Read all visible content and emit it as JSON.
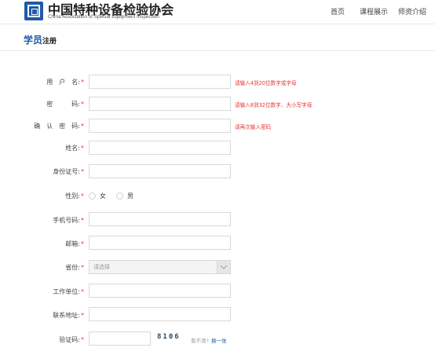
{
  "header": {
    "logo_cn": "中国特种设备检验协会",
    "logo_en": "China Association of Special Equipment Inspection",
    "nav": [
      "首页",
      "课程展示",
      "师资介绍"
    ]
  },
  "page_title": {
    "highlight": "学员",
    "rest": "注册"
  },
  "form": {
    "username": {
      "label": "用　户　名:",
      "hint": "请输入4到20位数字或字母"
    },
    "password": {
      "label": "密　　　码:",
      "hint": "请输入8到32位数字、大小写字母"
    },
    "confirm": {
      "label": "确　认　密　码:",
      "hint": "请再次输入密码"
    },
    "name": {
      "label": "姓名:"
    },
    "id_card": {
      "label": "身份证号:"
    },
    "gender": {
      "label": "性别:",
      "options": [
        "女",
        "男"
      ]
    },
    "phone": {
      "label": "手机号码:"
    },
    "email": {
      "label": "邮箱:"
    },
    "province": {
      "label": "省份:",
      "placeholder": "请选择"
    },
    "company": {
      "label": "工作单位:"
    },
    "address": {
      "label": "联系地址:"
    },
    "captcha": {
      "label": "验证码:",
      "code": "8106",
      "question": "看不清?",
      "refresh": "换一张"
    },
    "required_mark": "*"
  }
}
